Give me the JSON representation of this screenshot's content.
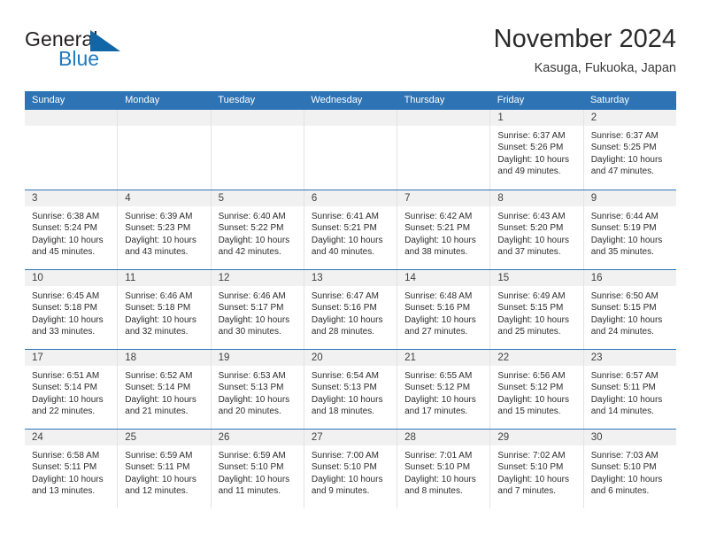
{
  "brand": {
    "word1": "General",
    "word2": "Blue",
    "logo_icon": "triangle-logo-icon",
    "color_dark": "#231f20",
    "color_blue": "#1f7ac0"
  },
  "header": {
    "title": "November 2024",
    "subtitle": "Kasuga, Fukuoka, Japan"
  },
  "theme": {
    "header_blue": "#2e74b5",
    "day_band_gray": "#f1f1f1",
    "cell_border": "#e3e3e3",
    "text": "#2c2c2c"
  },
  "weekdays": [
    "Sunday",
    "Monday",
    "Tuesday",
    "Wednesday",
    "Thursday",
    "Friday",
    "Saturday"
  ],
  "weeks": [
    [
      {
        "day": "",
        "sunrise": "",
        "sunset": "",
        "daylight": ""
      },
      {
        "day": "",
        "sunrise": "",
        "sunset": "",
        "daylight": ""
      },
      {
        "day": "",
        "sunrise": "",
        "sunset": "",
        "daylight": ""
      },
      {
        "day": "",
        "sunrise": "",
        "sunset": "",
        "daylight": ""
      },
      {
        "day": "",
        "sunrise": "",
        "sunset": "",
        "daylight": ""
      },
      {
        "day": "1",
        "sunrise": "Sunrise: 6:37 AM",
        "sunset": "Sunset: 5:26 PM",
        "daylight": "Daylight: 10 hours and 49 minutes."
      },
      {
        "day": "2",
        "sunrise": "Sunrise: 6:37 AM",
        "sunset": "Sunset: 5:25 PM",
        "daylight": "Daylight: 10 hours and 47 minutes."
      }
    ],
    [
      {
        "day": "3",
        "sunrise": "Sunrise: 6:38 AM",
        "sunset": "Sunset: 5:24 PM",
        "daylight": "Daylight: 10 hours and 45 minutes."
      },
      {
        "day": "4",
        "sunrise": "Sunrise: 6:39 AM",
        "sunset": "Sunset: 5:23 PM",
        "daylight": "Daylight: 10 hours and 43 minutes."
      },
      {
        "day": "5",
        "sunrise": "Sunrise: 6:40 AM",
        "sunset": "Sunset: 5:22 PM",
        "daylight": "Daylight: 10 hours and 42 minutes."
      },
      {
        "day": "6",
        "sunrise": "Sunrise: 6:41 AM",
        "sunset": "Sunset: 5:21 PM",
        "daylight": "Daylight: 10 hours and 40 minutes."
      },
      {
        "day": "7",
        "sunrise": "Sunrise: 6:42 AM",
        "sunset": "Sunset: 5:21 PM",
        "daylight": "Daylight: 10 hours and 38 minutes."
      },
      {
        "day": "8",
        "sunrise": "Sunrise: 6:43 AM",
        "sunset": "Sunset: 5:20 PM",
        "daylight": "Daylight: 10 hours and 37 minutes."
      },
      {
        "day": "9",
        "sunrise": "Sunrise: 6:44 AM",
        "sunset": "Sunset: 5:19 PM",
        "daylight": "Daylight: 10 hours and 35 minutes."
      }
    ],
    [
      {
        "day": "10",
        "sunrise": "Sunrise: 6:45 AM",
        "sunset": "Sunset: 5:18 PM",
        "daylight": "Daylight: 10 hours and 33 minutes."
      },
      {
        "day": "11",
        "sunrise": "Sunrise: 6:46 AM",
        "sunset": "Sunset: 5:18 PM",
        "daylight": "Daylight: 10 hours and 32 minutes."
      },
      {
        "day": "12",
        "sunrise": "Sunrise: 6:46 AM",
        "sunset": "Sunset: 5:17 PM",
        "daylight": "Daylight: 10 hours and 30 minutes."
      },
      {
        "day": "13",
        "sunrise": "Sunrise: 6:47 AM",
        "sunset": "Sunset: 5:16 PM",
        "daylight": "Daylight: 10 hours and 28 minutes."
      },
      {
        "day": "14",
        "sunrise": "Sunrise: 6:48 AM",
        "sunset": "Sunset: 5:16 PM",
        "daylight": "Daylight: 10 hours and 27 minutes."
      },
      {
        "day": "15",
        "sunrise": "Sunrise: 6:49 AM",
        "sunset": "Sunset: 5:15 PM",
        "daylight": "Daylight: 10 hours and 25 minutes."
      },
      {
        "day": "16",
        "sunrise": "Sunrise: 6:50 AM",
        "sunset": "Sunset: 5:15 PM",
        "daylight": "Daylight: 10 hours and 24 minutes."
      }
    ],
    [
      {
        "day": "17",
        "sunrise": "Sunrise: 6:51 AM",
        "sunset": "Sunset: 5:14 PM",
        "daylight": "Daylight: 10 hours and 22 minutes."
      },
      {
        "day": "18",
        "sunrise": "Sunrise: 6:52 AM",
        "sunset": "Sunset: 5:14 PM",
        "daylight": "Daylight: 10 hours and 21 minutes."
      },
      {
        "day": "19",
        "sunrise": "Sunrise: 6:53 AM",
        "sunset": "Sunset: 5:13 PM",
        "daylight": "Daylight: 10 hours and 20 minutes."
      },
      {
        "day": "20",
        "sunrise": "Sunrise: 6:54 AM",
        "sunset": "Sunset: 5:13 PM",
        "daylight": "Daylight: 10 hours and 18 minutes."
      },
      {
        "day": "21",
        "sunrise": "Sunrise: 6:55 AM",
        "sunset": "Sunset: 5:12 PM",
        "daylight": "Daylight: 10 hours and 17 minutes."
      },
      {
        "day": "22",
        "sunrise": "Sunrise: 6:56 AM",
        "sunset": "Sunset: 5:12 PM",
        "daylight": "Daylight: 10 hours and 15 minutes."
      },
      {
        "day": "23",
        "sunrise": "Sunrise: 6:57 AM",
        "sunset": "Sunset: 5:11 PM",
        "daylight": "Daylight: 10 hours and 14 minutes."
      }
    ],
    [
      {
        "day": "24",
        "sunrise": "Sunrise: 6:58 AM",
        "sunset": "Sunset: 5:11 PM",
        "daylight": "Daylight: 10 hours and 13 minutes."
      },
      {
        "day": "25",
        "sunrise": "Sunrise: 6:59 AM",
        "sunset": "Sunset: 5:11 PM",
        "daylight": "Daylight: 10 hours and 12 minutes."
      },
      {
        "day": "26",
        "sunrise": "Sunrise: 6:59 AM",
        "sunset": "Sunset: 5:10 PM",
        "daylight": "Daylight: 10 hours and 11 minutes."
      },
      {
        "day": "27",
        "sunrise": "Sunrise: 7:00 AM",
        "sunset": "Sunset: 5:10 PM",
        "daylight": "Daylight: 10 hours and 9 minutes."
      },
      {
        "day": "28",
        "sunrise": "Sunrise: 7:01 AM",
        "sunset": "Sunset: 5:10 PM",
        "daylight": "Daylight: 10 hours and 8 minutes."
      },
      {
        "day": "29",
        "sunrise": "Sunrise: 7:02 AM",
        "sunset": "Sunset: 5:10 PM",
        "daylight": "Daylight: 10 hours and 7 minutes."
      },
      {
        "day": "30",
        "sunrise": "Sunrise: 7:03 AM",
        "sunset": "Sunset: 5:10 PM",
        "daylight": "Daylight: 10 hours and 6 minutes."
      }
    ]
  ]
}
